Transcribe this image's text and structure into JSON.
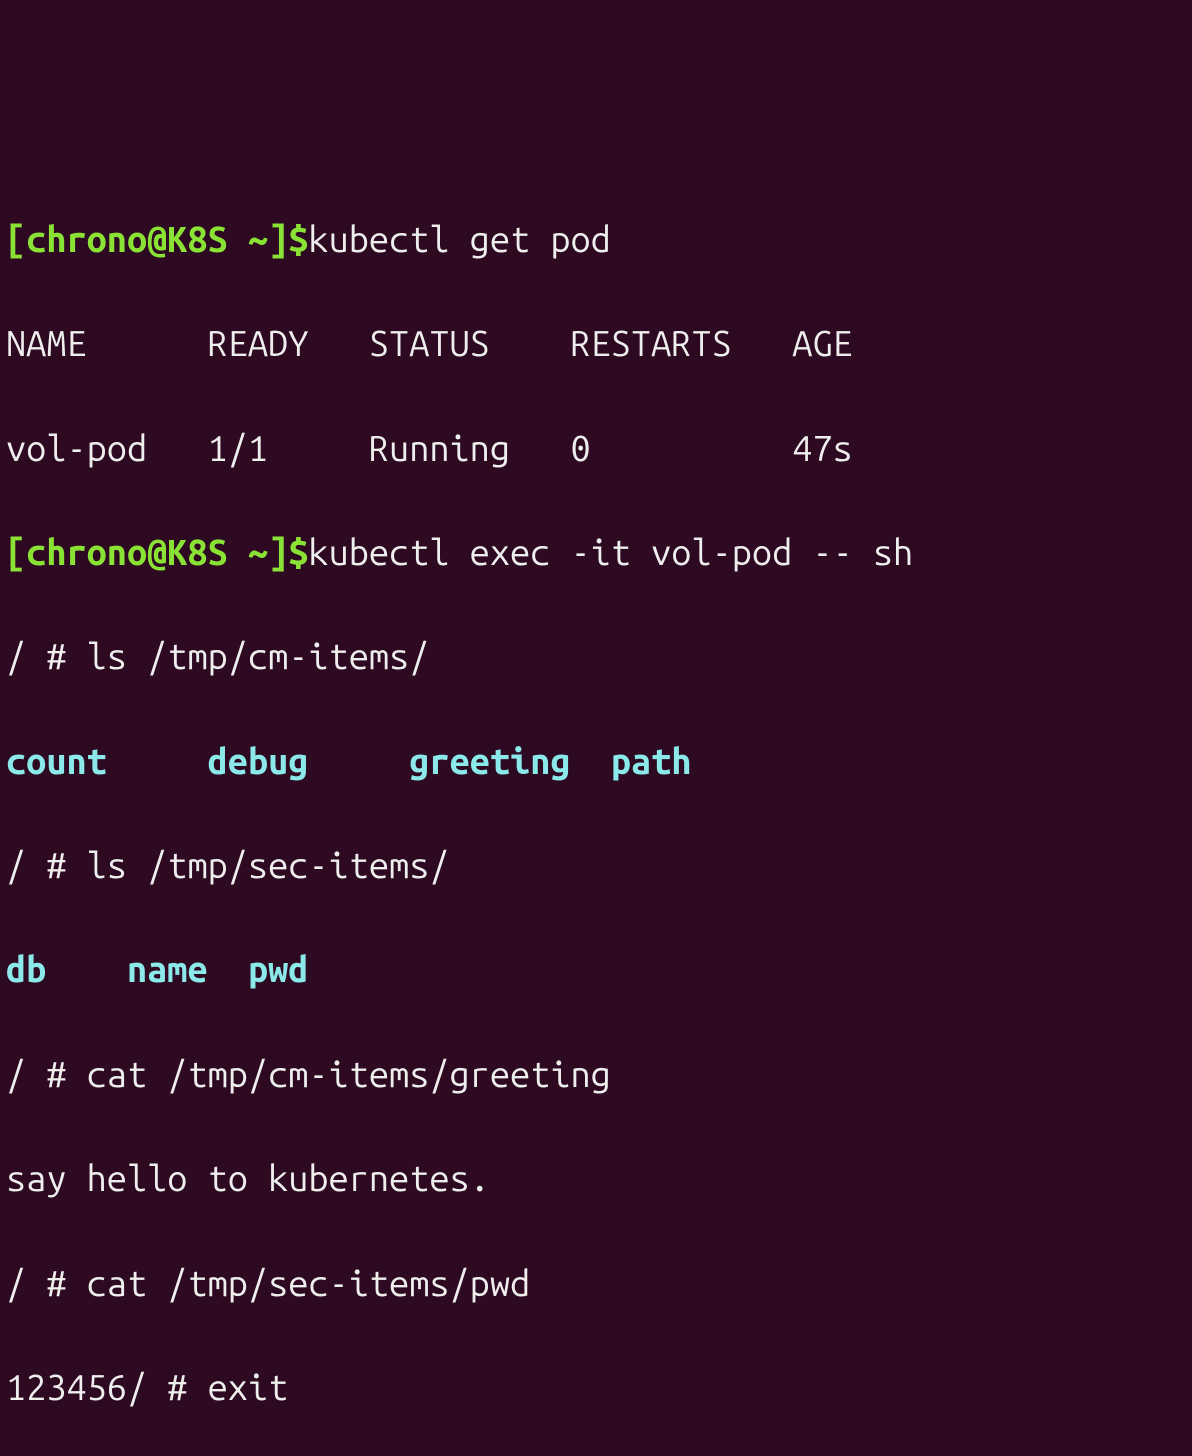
{
  "prompt": "[chrono@K8S ~]$",
  "cmd1": "kubectl get pod",
  "table_header": "NAME      READY   STATUS    RESTARTS   AGE",
  "table_row": "vol-pod   1/1     Running   0          47s",
  "cmd2": "kubectl exec -it vol-pod -- sh",
  "shell_prompt": "/ # ",
  "shell_cmd1": "ls /tmp/cm-items/",
  "ls1": {
    "a": "count",
    "b": "debug",
    "c": "greeting",
    "d": "path"
  },
  "shell_cmd2": "ls /tmp/sec-items/",
  "ls2": {
    "a": "db",
    "b": "name",
    "c": "pwd"
  },
  "shell_cmd3": "cat /tmp/cm-items/greeting",
  "cat1_output": "say hello to kubernetes.",
  "shell_cmd4": "cat /tmp/sec-items/pwd",
  "cat2_output": "123456",
  "shell_cmd5": "exit"
}
